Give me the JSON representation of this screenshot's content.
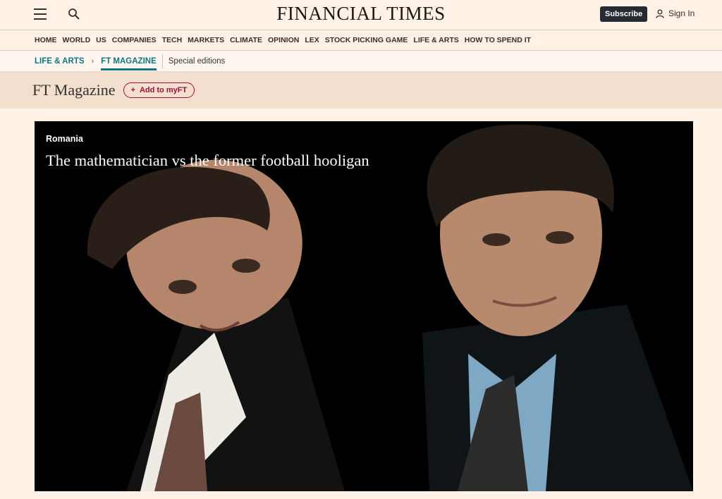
{
  "header": {
    "brand": "FINANCIAL TIMES",
    "subscribe_label": "Subscribe",
    "signin_label": "Sign In"
  },
  "nav": {
    "items": [
      "HOME",
      "WORLD",
      "US",
      "COMPANIES",
      "TECH",
      "MARKETS",
      "CLIMATE",
      "OPINION",
      "LEX",
      "STOCK PICKING GAME",
      "LIFE & ARTS",
      "HOW TO SPEND IT"
    ]
  },
  "breadcrumb": {
    "parent": "LIFE & ARTS",
    "current": "FT MAGAZINE",
    "extra": "Special editions"
  },
  "section": {
    "title": "FT Magazine",
    "myft_label": "Add to myFT"
  },
  "hero": {
    "tag": "Romania",
    "title": "The mathematician vs the former football hooligan"
  },
  "colors": {
    "background": "#fff1e5",
    "teal": "#0d7680",
    "claret": "#990f3d",
    "subscribe": "#262a33"
  }
}
